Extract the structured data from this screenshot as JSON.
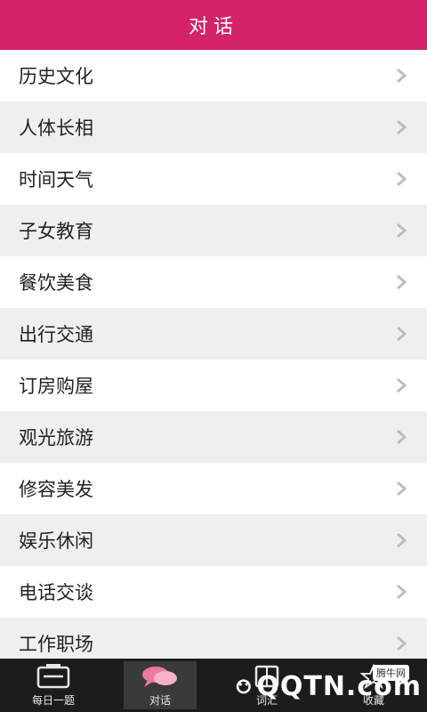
{
  "header": {
    "title": "对话"
  },
  "list": {
    "items": [
      "历史文化",
      "人体长相",
      "时间天气",
      "子女教育",
      "餐饮美食",
      "出行交通",
      "订房购屋",
      "观光旅游",
      "修容美发",
      "娱乐休闲",
      "电话交谈",
      "工作职场"
    ]
  },
  "tabbar": {
    "tabs": [
      {
        "label": "每日一题",
        "icon": "calendar-icon"
      },
      {
        "label": "对话",
        "icon": "chat-bubbles-icon"
      },
      {
        "label": "词汇",
        "icon": "book-icon"
      },
      {
        "label": "收藏",
        "icon": "star-icon"
      }
    ]
  },
  "watermark": {
    "brand": "QQTN.com",
    "small": "腾牛网"
  },
  "colors": {
    "header": "#d22467",
    "tabbar": "#1c1c1c",
    "chat_icon": "#e87b9e"
  }
}
